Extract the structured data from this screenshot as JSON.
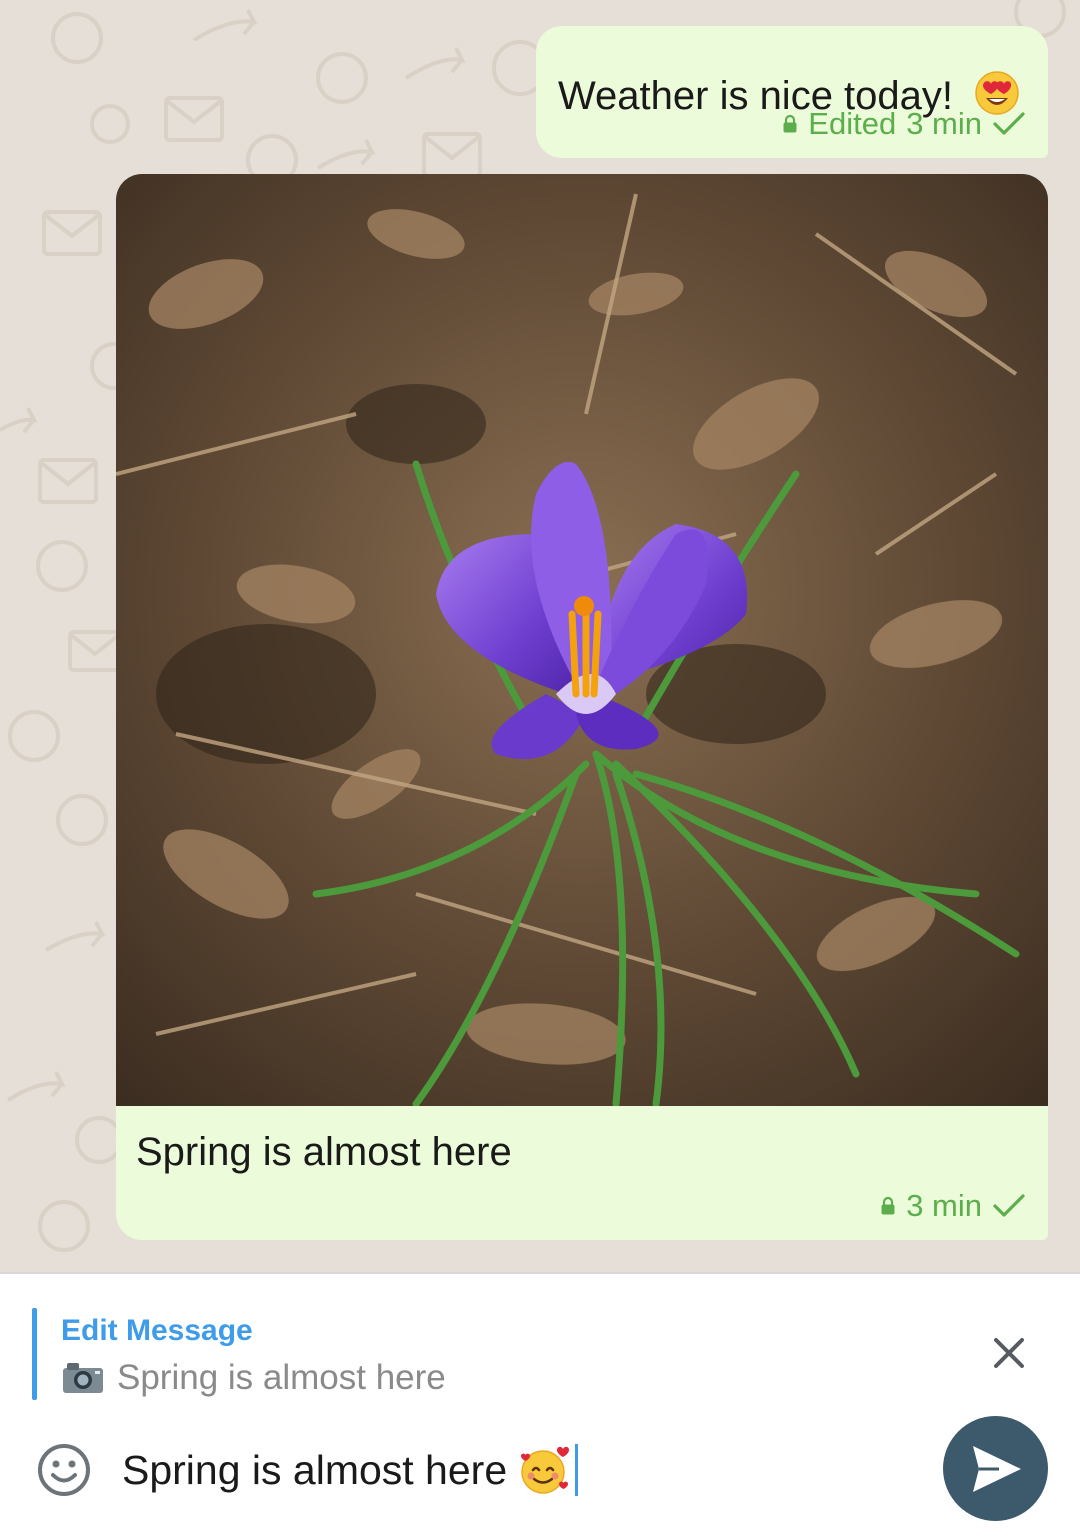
{
  "messages": [
    {
      "text": "Weather is nice today!",
      "emoji": "heart-eyes-emoji",
      "edited_label": "Edited",
      "time": "3 min",
      "status": "sent-check"
    },
    {
      "image": "purple-crocus-photo",
      "caption": "Spring is almost here",
      "time": "3 min",
      "status": "sent-check"
    }
  ],
  "edit_panel": {
    "title": "Edit Message",
    "preview_icon": "camera-icon",
    "preview_text": "Spring is almost here"
  },
  "composer": {
    "text": "Spring is almost here",
    "trailing_emoji": "smiling-hearts-emoji"
  },
  "colors": {
    "bubble": "#ecfbd9",
    "meta_green": "#5cae4d",
    "accent_blue": "#3e9ce8",
    "send_button": "#3d5a6c",
    "chat_background": "#e6dfd7"
  }
}
